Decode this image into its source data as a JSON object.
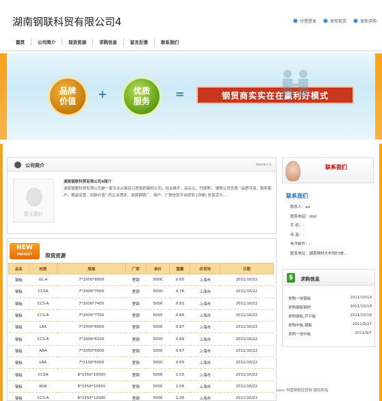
{
  "header": {
    "title": "湖南钢联科贸有限公司4",
    "links": [
      "付借登录",
      "发布现货",
      "发布求购"
    ]
  },
  "nav": [
    "首页",
    "公司简介",
    "现货资源",
    "求购信息",
    "留言反馈",
    "联系我们"
  ],
  "banner": {
    "badge1": [
      "品牌",
      "价值"
    ],
    "badge2": [
      "优质",
      "服务"
    ],
    "plus": "+",
    "equals": "=",
    "slogan": "钢贸商实实在在赢利好模式"
  },
  "intro": {
    "title": "公司简介",
    "more": "more<<",
    "noimg": "暂无图片",
    "name": "湖南钢联科贸有限公司4简介",
    "text": "湖南钢联科贸有限公司是一家专业从事百兴贸易的钢材公司，经合格手、高合公、竹境等。 钢联公司负责 “品质可用、服务客户、精益运营、创新价值” 的企业理念，选择钢铁厂、商户、广铁信息平台提供 [详细] 信息活力...."
  },
  "goods": {
    "badge": "NEW",
    "badge_sub": "PRODUCT",
    "title": "现货资源",
    "columns": [
      "品名",
      "材质",
      "规格",
      "厂家",
      "单价",
      "重量",
      "存货地",
      "日期"
    ],
    "rows": [
      [
        "钢板",
        "GL-A",
        "7*2000*8000",
        "里钢",
        "5000",
        "0.65",
        "上海市",
        "2011/10/22"
      ],
      [
        "钢板",
        "CCSA",
        "7*2000*7000",
        "里钢",
        "5000",
        "0.76",
        "上海市",
        "2011/10/22"
      ],
      [
        "钢板",
        "CCS-A",
        "7*2000*7400",
        "里钢",
        "5000",
        "0.81",
        "上海市",
        "2011/10/22"
      ],
      [
        "钢板",
        "CCS-A",
        "7*2000*7700",
        "里钢",
        "5000",
        "0.84",
        "上海市",
        "2011/10/22"
      ],
      [
        "钢板",
        "LRA",
        "7*2000*8000",
        "里钢",
        "5000",
        "0.87",
        "上海市",
        "2011/10/22"
      ],
      [
        "钢板",
        "CCS-A",
        "7*2000*8100",
        "里钢",
        "5000",
        "0.89",
        "上海市",
        "2011/10/22"
      ],
      [
        "钢板",
        "ABA",
        "7*2050*6000",
        "里钢",
        "5000",
        "0.67",
        "上海市",
        "2011/10/22"
      ],
      [
        "钢板",
        "LRA",
        "7*2100*6000",
        "里钢",
        "5000",
        "0.69",
        "上海市",
        "2011/10/22"
      ],
      [
        "钢板",
        "CCSA",
        "8*1550*10000",
        "里钢",
        "5000",
        "1.03",
        "上海市",
        "2011/10/22"
      ],
      [
        "钢板",
        "NVA",
        "8*1550*10500",
        "里钢",
        "5000",
        "1.05",
        "上海市",
        "2011/10/22"
      ],
      [
        "钢板",
        "CCS-A",
        "8*1550*12000",
        "里钢",
        "5000",
        "1.24",
        "上海市",
        "2011/10/22"
      ]
    ]
  },
  "contact": {
    "banner_text": "联系我们",
    "title": "联系我们",
    "items": [
      "联系人：aa",
      "联系电话：ddd",
      "手 机：-",
      "传 真：-",
      "电子邮件：-",
      "联系地址：湖南钢材大市场E3栋..."
    ]
  },
  "buy": {
    "title": "求购信息",
    "rows": [
      {
        "name": "求购一块钢板",
        "date": "2011/10/19"
      },
      {
        "name": "求购钢板钢材",
        "date": "2011/10/18"
      },
      {
        "name": "求购钢板,开平板",
        "date": "2011/10/18"
      },
      {
        "name": "求购中板,钢板",
        "date": "2011/9/27"
      },
      {
        "name": "求购一块中板",
        "date": "2011/9/7"
      }
    ]
  },
  "footer": {
    "text": "com 中国钢铁现货网 版权所有"
  }
}
